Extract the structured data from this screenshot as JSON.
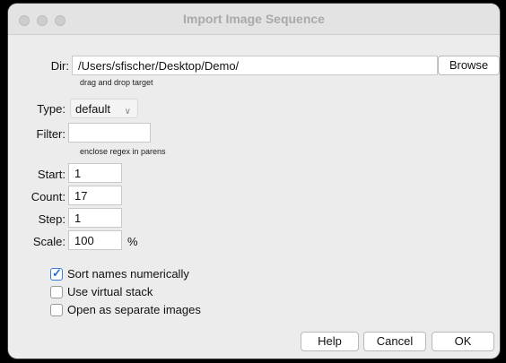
{
  "window": {
    "title": "Import Image Sequence"
  },
  "dir": {
    "label": "Dir:",
    "value": "/Users/sfischer/Desktop/Demo/",
    "hint": "drag and drop target",
    "browse": "Browse"
  },
  "type": {
    "label": "Type:",
    "value": "default"
  },
  "filter": {
    "label": "Filter:",
    "value": "",
    "hint": "enclose regex in parens"
  },
  "start": {
    "label": "Start:",
    "value": "1"
  },
  "count": {
    "label": "Count:",
    "value": "17"
  },
  "step": {
    "label": "Step:",
    "value": "1"
  },
  "scale": {
    "label": "Scale:",
    "value": "100",
    "unit": "%"
  },
  "options": [
    {
      "label": "Sort names numerically",
      "checked": true
    },
    {
      "label": "Use virtual stack",
      "checked": false
    },
    {
      "label": "Open as separate images",
      "checked": false
    }
  ],
  "buttons": {
    "help": "Help",
    "cancel": "Cancel",
    "ok": "OK"
  }
}
